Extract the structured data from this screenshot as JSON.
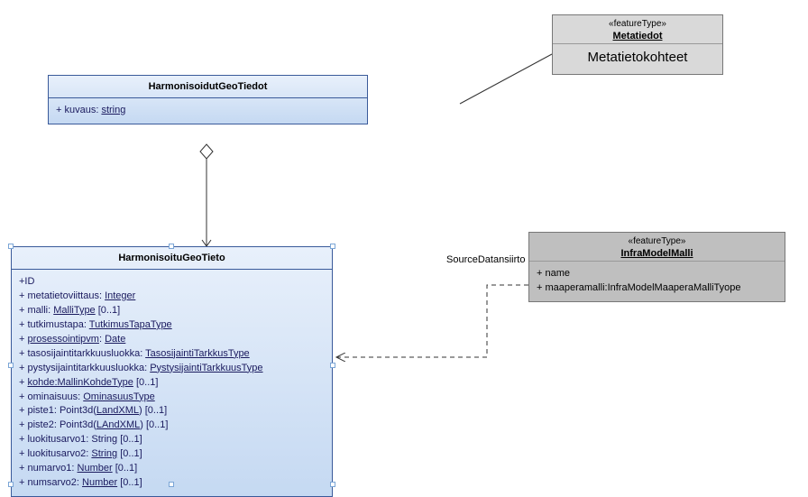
{
  "classes": {
    "harmonisoidutGeoTiedot": {
      "title": "HarmonisoidutGeoTiedot",
      "attr0_prefix": "+ kuvaus: ",
      "attr0_type": "string"
    },
    "harmonisoituGeoTieto": {
      "title": "HarmonisoituGeoTieto",
      "a0": "+ID",
      "a1_p": "+ metatietoviittaus: ",
      "a1_t": "Integer",
      "a2_p": "+ malli: ",
      "a2_t": "MalliType",
      "a2_s": " [0..1]",
      "a3_p": "+ tutkimustapa: ",
      "a3_t": "TutkimusTapaType",
      "a4_p": "+ ",
      "a4_t": "prosessointipvm",
      "a4_m": ": ",
      "a4_t2": "Date",
      "a5_p": "+ tasosijaintitarkkuusluokka: ",
      "a5_t": "TasosijaintiTarkkusType",
      "a6_p": "+ pystysijaintitarkkuusluokka: ",
      "a6_t": "PystysijaintiTarkkuusType",
      "a7_p": "+ ",
      "a7_t": "kohde:MallinKohdeType",
      "a7_s": " [0..1]",
      "a8_p": "+ ominaisuus: ",
      "a8_t": "OminasuusType",
      "a9_p": "+ piste1: Point3d(",
      "a9_t": "LandXML",
      "a9_s": ") [0..1]",
      "a10_p": "+ piste2: Point3d(",
      "a10_t": "LAndXML",
      "a10_s": ") [0..1]",
      "a11_p": "+ luokitusarvo1: String [0..1]",
      "a12_p": "+ luokitusarvo2: ",
      "a12_t": "String",
      "a12_s": " [0..1]",
      "a13_p": "+ numarvo1: ",
      "a13_t": "Number",
      "a13_s": " [0..1]",
      "a14_p": "+ numsarvo2: ",
      "a14_t": "Number",
      "a14_s": " [0..1]"
    },
    "metatiedot": {
      "stereo": "«featureType»",
      "title": "Metatiedot",
      "sub": "Metatietokohteet"
    },
    "infraModelMalli": {
      "stereo": "«featureType»",
      "title": "InfraModelMalli",
      "a0": "+ name",
      "a1": "+ maaperamalli:InfraModelMaaperaMalliTyope"
    }
  },
  "relLabel": "SourceDatansiirto"
}
